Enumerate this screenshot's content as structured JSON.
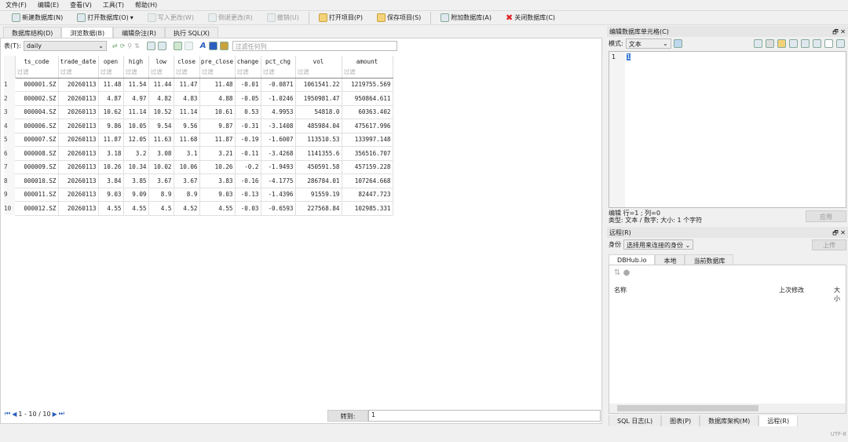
{
  "menu": [
    "文件(F)",
    "编辑(E)",
    "查看(V)",
    "工具(T)",
    "帮助(H)"
  ],
  "toolbar": [
    {
      "label": "新建数据库(N)",
      "enabled": true
    },
    {
      "label": "打开数据库(O)",
      "enabled": true
    },
    {
      "label": "写入更改(W)",
      "enabled": false
    },
    {
      "label": "倒退更改(R)",
      "enabled": false
    },
    {
      "label": "撤销(U)",
      "enabled": false
    },
    {
      "label": "打开项目(P)",
      "enabled": true
    },
    {
      "label": "保存项目(S)",
      "enabled": true
    },
    {
      "label": "附加数据库(A)",
      "enabled": true
    },
    {
      "label": "关闭数据库(C)",
      "enabled": true
    }
  ],
  "main_tabs": [
    "数据库结构(D)",
    "浏览数据(B)",
    "编辑杂注(R)",
    "执行 SQL(X)"
  ],
  "active_tab": 1,
  "browse": {
    "table_label": "表(T):",
    "table": "daily",
    "filter_placeholder": "过滤任何列"
  },
  "columns": [
    "ts_code",
    "trade_date",
    "open",
    "high",
    "low",
    "close",
    "pre_close",
    "change",
    "pct_chg",
    "vol",
    "amount"
  ],
  "filter_placeholder": "过滤",
  "rows": [
    [
      "000001.SZ",
      "20260113",
      "11.48",
      "11.54",
      "11.44",
      "11.47",
      "11.48",
      "-0.01",
      "-0.0871",
      "1061541.22",
      "1219755.569"
    ],
    [
      "000002.SZ",
      "20260113",
      "4.87",
      "4.97",
      "4.82",
      "4.83",
      "4.88",
      "-0.05",
      "-1.0246",
      "1950981.47",
      "950864.611"
    ],
    [
      "000004.SZ",
      "20260113",
      "10.62",
      "11.14",
      "10.52",
      "11.14",
      "10.61",
      "0.53",
      "4.9953",
      "54818.0",
      "60363.402"
    ],
    [
      "000006.SZ",
      "20260113",
      "9.86",
      "10.05",
      "9.54",
      "9.56",
      "9.87",
      "-0.31",
      "-3.1408",
      "485984.04",
      "475617.996"
    ],
    [
      "000007.SZ",
      "20260113",
      "11.87",
      "12.05",
      "11.63",
      "11.68",
      "11.87",
      "-0.19",
      "-1.6007",
      "113510.53",
      "133997.148"
    ],
    [
      "000008.SZ",
      "20260113",
      "3.18",
      "3.2",
      "3.08",
      "3.1",
      "3.21",
      "-0.11",
      "-3.4268",
      "1141355.6",
      "356516.707"
    ],
    [
      "000009.SZ",
      "20260113",
      "10.26",
      "10.34",
      "10.02",
      "10.06",
      "10.26",
      "-0.2",
      "-1.9493",
      "450591.58",
      "457159.228"
    ],
    [
      "000010.SZ",
      "20260113",
      "3.84",
      "3.85",
      "3.67",
      "3.67",
      "3.83",
      "-0.16",
      "-4.1775",
      "286784.01",
      "107264.668"
    ],
    [
      "000011.SZ",
      "20260113",
      "9.03",
      "9.09",
      "8.9",
      "8.9",
      "9.03",
      "-0.13",
      "-1.4396",
      "91559.19",
      "82447.723"
    ],
    [
      "000012.SZ",
      "20260113",
      "4.55",
      "4.55",
      "4.5",
      "4.52",
      "4.55",
      "-0.03",
      "-0.6593",
      "227568.84",
      "102985.331"
    ]
  ],
  "pagination": {
    "range": "1 - 10 / 10",
    "goto_label": "转到:",
    "goto_value": "1"
  },
  "edit_cell": {
    "title": "编辑数据库单元格(C)",
    "mode_label": "模式:",
    "mode": "文本",
    "line_no": "1",
    "content": "1",
    "status1": "编辑 行=1 ; 列=0",
    "status2": "类型: 文本 / 数字; 大小: 1 个字符",
    "apply": "应用"
  },
  "remote": {
    "title": "远程(R)",
    "identity_label": "身份",
    "identity": "选择用来连接的身份",
    "upload": "上传",
    "tabs": [
      "DBHub.io",
      "本地",
      "当前数据库"
    ],
    "col_name": "名称",
    "col_modified": "上次修改",
    "col_size": "大小"
  },
  "bottom_tabs": [
    "SQL 日志(L)",
    "图表(P)",
    "数据库架构(M)",
    "远程(R)"
  ],
  "active_bottom_tab": 3,
  "encoding": "UTF-8"
}
